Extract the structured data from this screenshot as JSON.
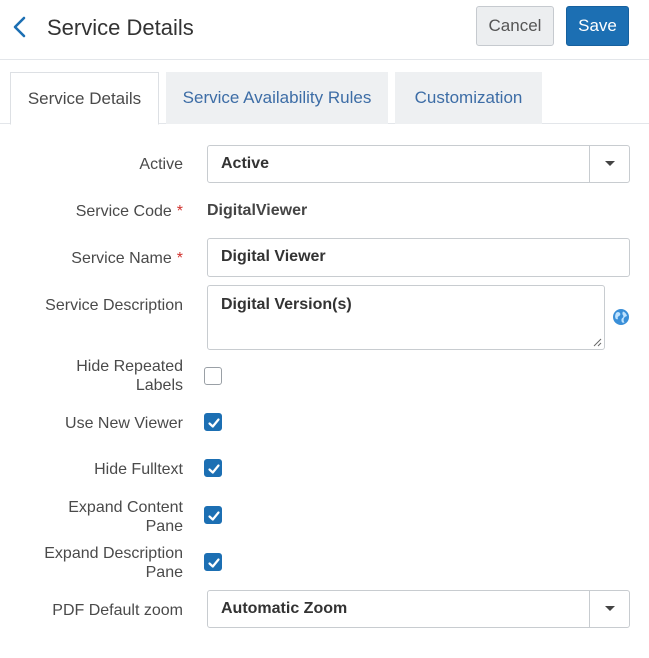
{
  "header": {
    "title": "Service Details",
    "cancel_label": "Cancel",
    "save_label": "Save"
  },
  "tabs": [
    {
      "label": "Service Details",
      "active": true
    },
    {
      "label": "Service Availability Rules",
      "active": false
    },
    {
      "label": "Customization",
      "active": false
    }
  ],
  "form": {
    "active": {
      "label": "Active",
      "value": "Active"
    },
    "service_code": {
      "label": "Service Code",
      "required_mark": "*",
      "value": "DigitalViewer"
    },
    "service_name": {
      "label": "Service Name",
      "required_mark": "*",
      "value": "Digital Viewer"
    },
    "service_description": {
      "label": "Service Description",
      "value": "Digital Version(s)"
    },
    "hide_repeated_labels": {
      "label_line1": "Hide Repeated",
      "label_line2": "Labels",
      "checked": false
    },
    "use_new_viewer": {
      "label": "Use New Viewer",
      "checked": true
    },
    "hide_fulltext": {
      "label": "Hide Fulltext",
      "checked": true
    },
    "expand_content_pane": {
      "label_line1": "Expand Content",
      "label_line2": "Pane",
      "checked": true
    },
    "expand_description_pane": {
      "label_line1": "Expand Description",
      "label_line2": "Pane",
      "checked": true
    },
    "pdf_default_zoom": {
      "label": "PDF Default zoom",
      "value": "Automatic Zoom"
    }
  },
  "icons": {
    "back": "chevron-left-icon",
    "dropdown": "caret-down-icon",
    "globe": "globe-icon",
    "check": "checkmark-icon"
  },
  "colors": {
    "primary": "#1c6fb3",
    "tab_link": "#3d6da6",
    "required": "#d0312d",
    "globe": "#3a8fd8"
  }
}
